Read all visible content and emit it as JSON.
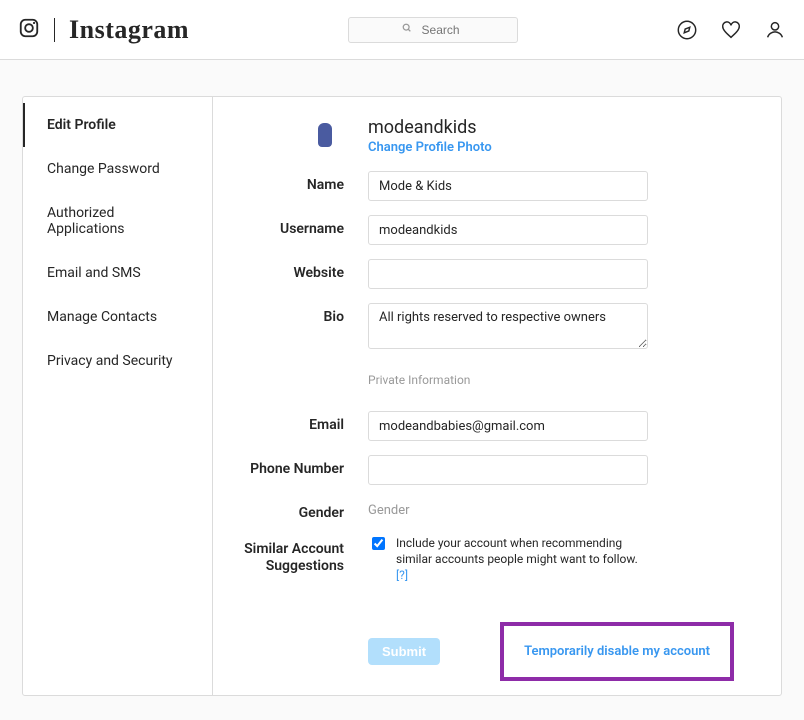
{
  "header": {
    "brand": "Instagram",
    "search_placeholder": "Search"
  },
  "sidebar": {
    "items": [
      {
        "label": "Edit Profile",
        "active": true
      },
      {
        "label": "Change Password"
      },
      {
        "label": "Authorized Applications"
      },
      {
        "label": "Email and SMS"
      },
      {
        "label": "Manage Contacts"
      },
      {
        "label": "Privacy and Security"
      }
    ]
  },
  "profile": {
    "username_display": "modeandkids",
    "change_photo_label": "Change Profile Photo",
    "labels": {
      "name": "Name",
      "username": "Username",
      "website": "Website",
      "bio": "Bio",
      "private_info": "Private Information",
      "email": "Email",
      "phone": "Phone Number",
      "gender": "Gender",
      "similar": "Similar Account Suggestions"
    },
    "values": {
      "name": "Mode & Kids",
      "username": "modeandkids",
      "website": "",
      "bio": "All rights reserved to respective owners",
      "email": "modeandbabies@gmail.com",
      "phone": "",
      "gender_placeholder": "Gender"
    },
    "similar_checkbox": {
      "checked": true,
      "text": "Include your account when recommending similar accounts people might want to follow.",
      "help": "[?]"
    },
    "submit_label": "Submit",
    "disable_link": "Temporarily disable my account"
  }
}
